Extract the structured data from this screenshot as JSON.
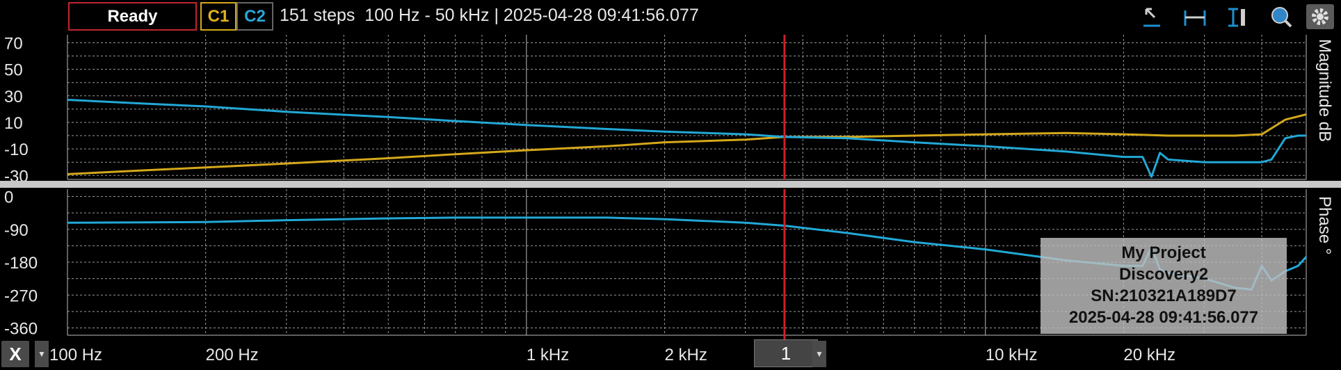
{
  "toolbar": {
    "status": "Ready",
    "channel1": "C1",
    "channel2": "C2",
    "info": "151 steps  100 Hz - 50 kHz | 2025-04-28 09:41:56.077",
    "icons": [
      "cursor-add-icon",
      "horizontal-cursor-icon",
      "vertical-cursor-icon",
      "zoom-icon",
      "settings-gear-icon"
    ]
  },
  "colors": {
    "c1": "#d4a81c",
    "c2": "#22a8d6",
    "cursor": "#d01f26",
    "grid": "#9a9a9a"
  },
  "magnitude": {
    "title": "Magnitude  dB"
  },
  "phase": {
    "title": "Phase  °"
  },
  "bottom": {
    "x_button": "X",
    "cursor_value": "1"
  },
  "watermark": {
    "line1": "My Project",
    "line2": "Discovery2",
    "line3": "SN:210321A189D7",
    "line4": "2025-04-28 09:41:56.077"
  },
  "chart_data": [
    {
      "type": "line",
      "xscale": "log",
      "xlim": [
        100,
        50000
      ],
      "x_ticks": [
        100,
        200,
        1000,
        2000,
        10000,
        20000
      ],
      "x_tick_labels": [
        "100 Hz",
        "200 Hz",
        "1 kHz",
        "2 kHz",
        "10 kHz",
        "20 kHz"
      ],
      "ylabel": "Magnitude  dB",
      "ylim": [
        -33,
        76
      ],
      "y_ticks": [
        70,
        50,
        30,
        10,
        -10,
        -30
      ],
      "grid": true,
      "cursor_x": 3650,
      "series": [
        {
          "name": "C1",
          "color": "#d4a81c",
          "x": [
            100,
            150,
            200,
            300,
            500,
            700,
            1000,
            1500,
            2000,
            3000,
            3650,
            5000,
            7000,
            10000,
            15000,
            20000,
            25000,
            30000,
            35000,
            40000,
            45000,
            50000
          ],
          "y": [
            -29,
            -26,
            -24,
            -21,
            -17,
            -14,
            -11,
            -8,
            -5,
            -3,
            -1,
            -1,
            0,
            1,
            2,
            1,
            0,
            0,
            0,
            1,
            12,
            16
          ]
        },
        {
          "name": "C2",
          "color": "#22a8d6",
          "x": [
            100,
            150,
            200,
            300,
            500,
            700,
            1000,
            1500,
            2000,
            3000,
            3650,
            5000,
            7000,
            10000,
            15000,
            20000,
            22000,
            23000,
            24000,
            25000,
            30000,
            35000,
            40000,
            42000,
            45000,
            48000,
            50000
          ],
          "y": [
            27,
            24,
            22,
            18,
            14,
            11,
            8,
            5,
            3,
            1,
            -1,
            -2,
            -5,
            -8,
            -12,
            -16,
            -16,
            -31,
            -13,
            -18,
            -20,
            -20,
            -20,
            -18,
            -2,
            0,
            0
          ]
        }
      ]
    },
    {
      "type": "line",
      "xscale": "log",
      "xlim": [
        100,
        50000
      ],
      "x_ticks": [
        100,
        200,
        1000,
        2000,
        10000,
        20000
      ],
      "x_tick_labels": [
        "100 Hz",
        "200 Hz",
        "1 kHz",
        "2 kHz",
        "10 kHz",
        "20 kHz"
      ],
      "ylabel": "Phase  °",
      "ylim": [
        -380,
        20
      ],
      "y_ticks": [
        0,
        -90,
        -180,
        -270,
        -360
      ],
      "grid": true,
      "cursor_x": 3650,
      "series": [
        {
          "name": "C2",
          "color": "#22a8d6",
          "x": [
            100,
            200,
            300,
            500,
            700,
            1000,
            1500,
            2000,
            3000,
            3650,
            5000,
            7000,
            10000,
            15000,
            20000,
            22000,
            23000,
            24000,
            25000,
            30000,
            35000,
            38000,
            40000,
            42000,
            45000,
            48000,
            50000
          ],
          "y": [
            -72,
            -70,
            -65,
            -60,
            -58,
            -58,
            -58,
            -62,
            -72,
            -80,
            -100,
            -125,
            -145,
            -175,
            -190,
            -190,
            -140,
            -200,
            -210,
            -225,
            -250,
            -255,
            -190,
            -230,
            -205,
            -190,
            -165
          ]
        }
      ]
    }
  ]
}
